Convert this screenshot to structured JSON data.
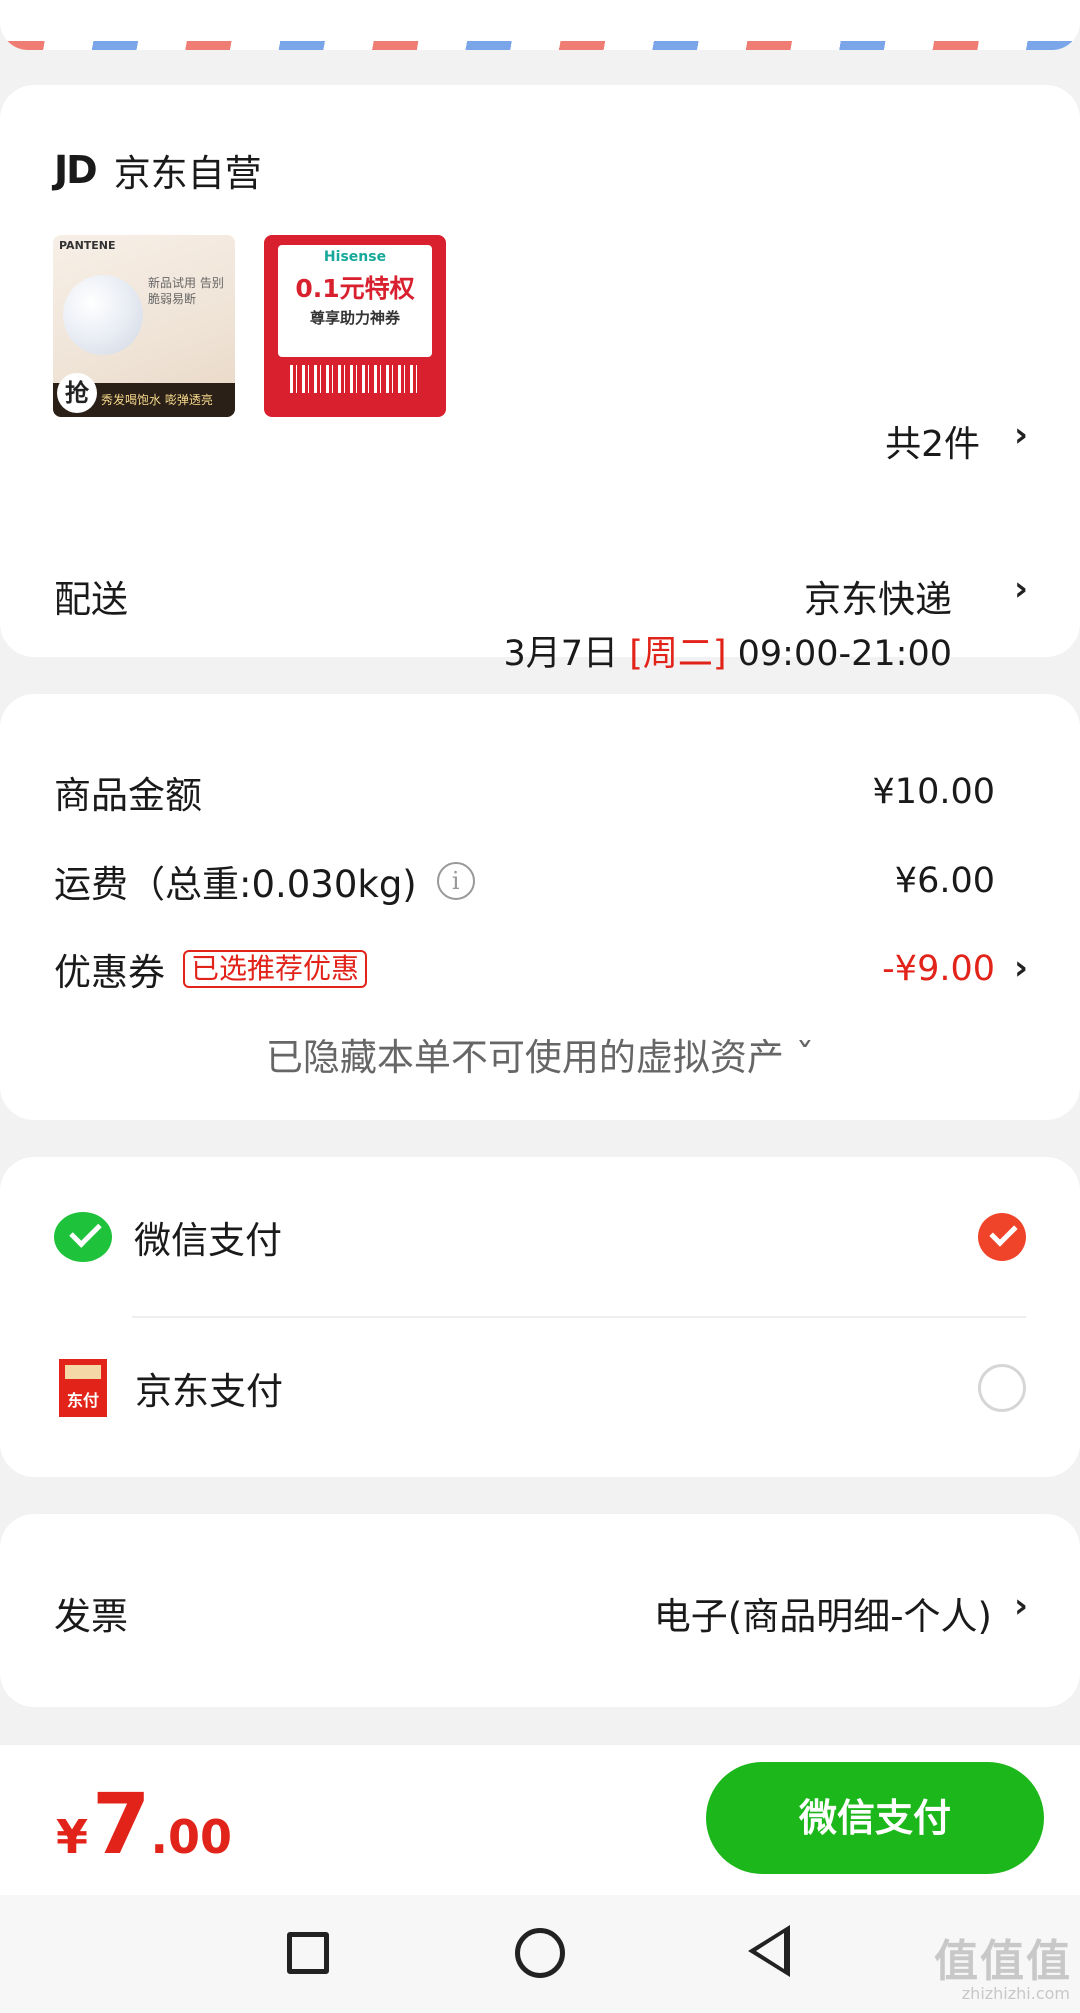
{
  "shop": {
    "logo": "JD",
    "name": "京东自营",
    "count_label": "共2件",
    "thumb1": {
      "brand": "PANTENE",
      "text": "新品试用 告别脆弱易断",
      "banner": "秀发喝饱水 嘭弹透亮",
      "badge": "抢"
    },
    "thumb2": {
      "brand": "Hisense",
      "headline": "0.1元特权",
      "subline": "尊享助力神券"
    }
  },
  "delivery": {
    "label": "配送",
    "method": "京东快递",
    "date": "3月7日",
    "weekday": "[周二]",
    "time": "09:00-21:00"
  },
  "price": {
    "goods_label": "商品金额",
    "goods_value": "¥10.00",
    "shipping_label": "运费（总重:0.030kg)",
    "shipping_value": "¥6.00",
    "coupon_label": "优惠券",
    "coupon_tag": "已选推荐优惠",
    "coupon_value": "-¥9.00",
    "hidden_note": "已隐藏本单不可使用的虚拟资产 ˇ"
  },
  "payment": {
    "wechat_label": "微信支付",
    "jdpay_label": "京东支付",
    "jdpay_icon_text": "东付",
    "selected": "wechat"
  },
  "invoice": {
    "label": "发票",
    "value": "电子(商品明细-个人)"
  },
  "bottom": {
    "currency": "¥",
    "total_int": "7",
    "total_dec": ".00",
    "pay_button": "微信支付"
  },
  "watermark": {
    "main": "值值值",
    "sub": "zhizhizhi.com"
  },
  "colors": {
    "accent_red": "#e2231a",
    "wechat_green": "#1cb71a",
    "radio_selected": "#f0442a"
  },
  "icons": {
    "chevron": "chevron-right-icon",
    "info": "info-icon",
    "wechat": "wechat-pay-icon",
    "jdpay": "jd-pay-icon"
  }
}
